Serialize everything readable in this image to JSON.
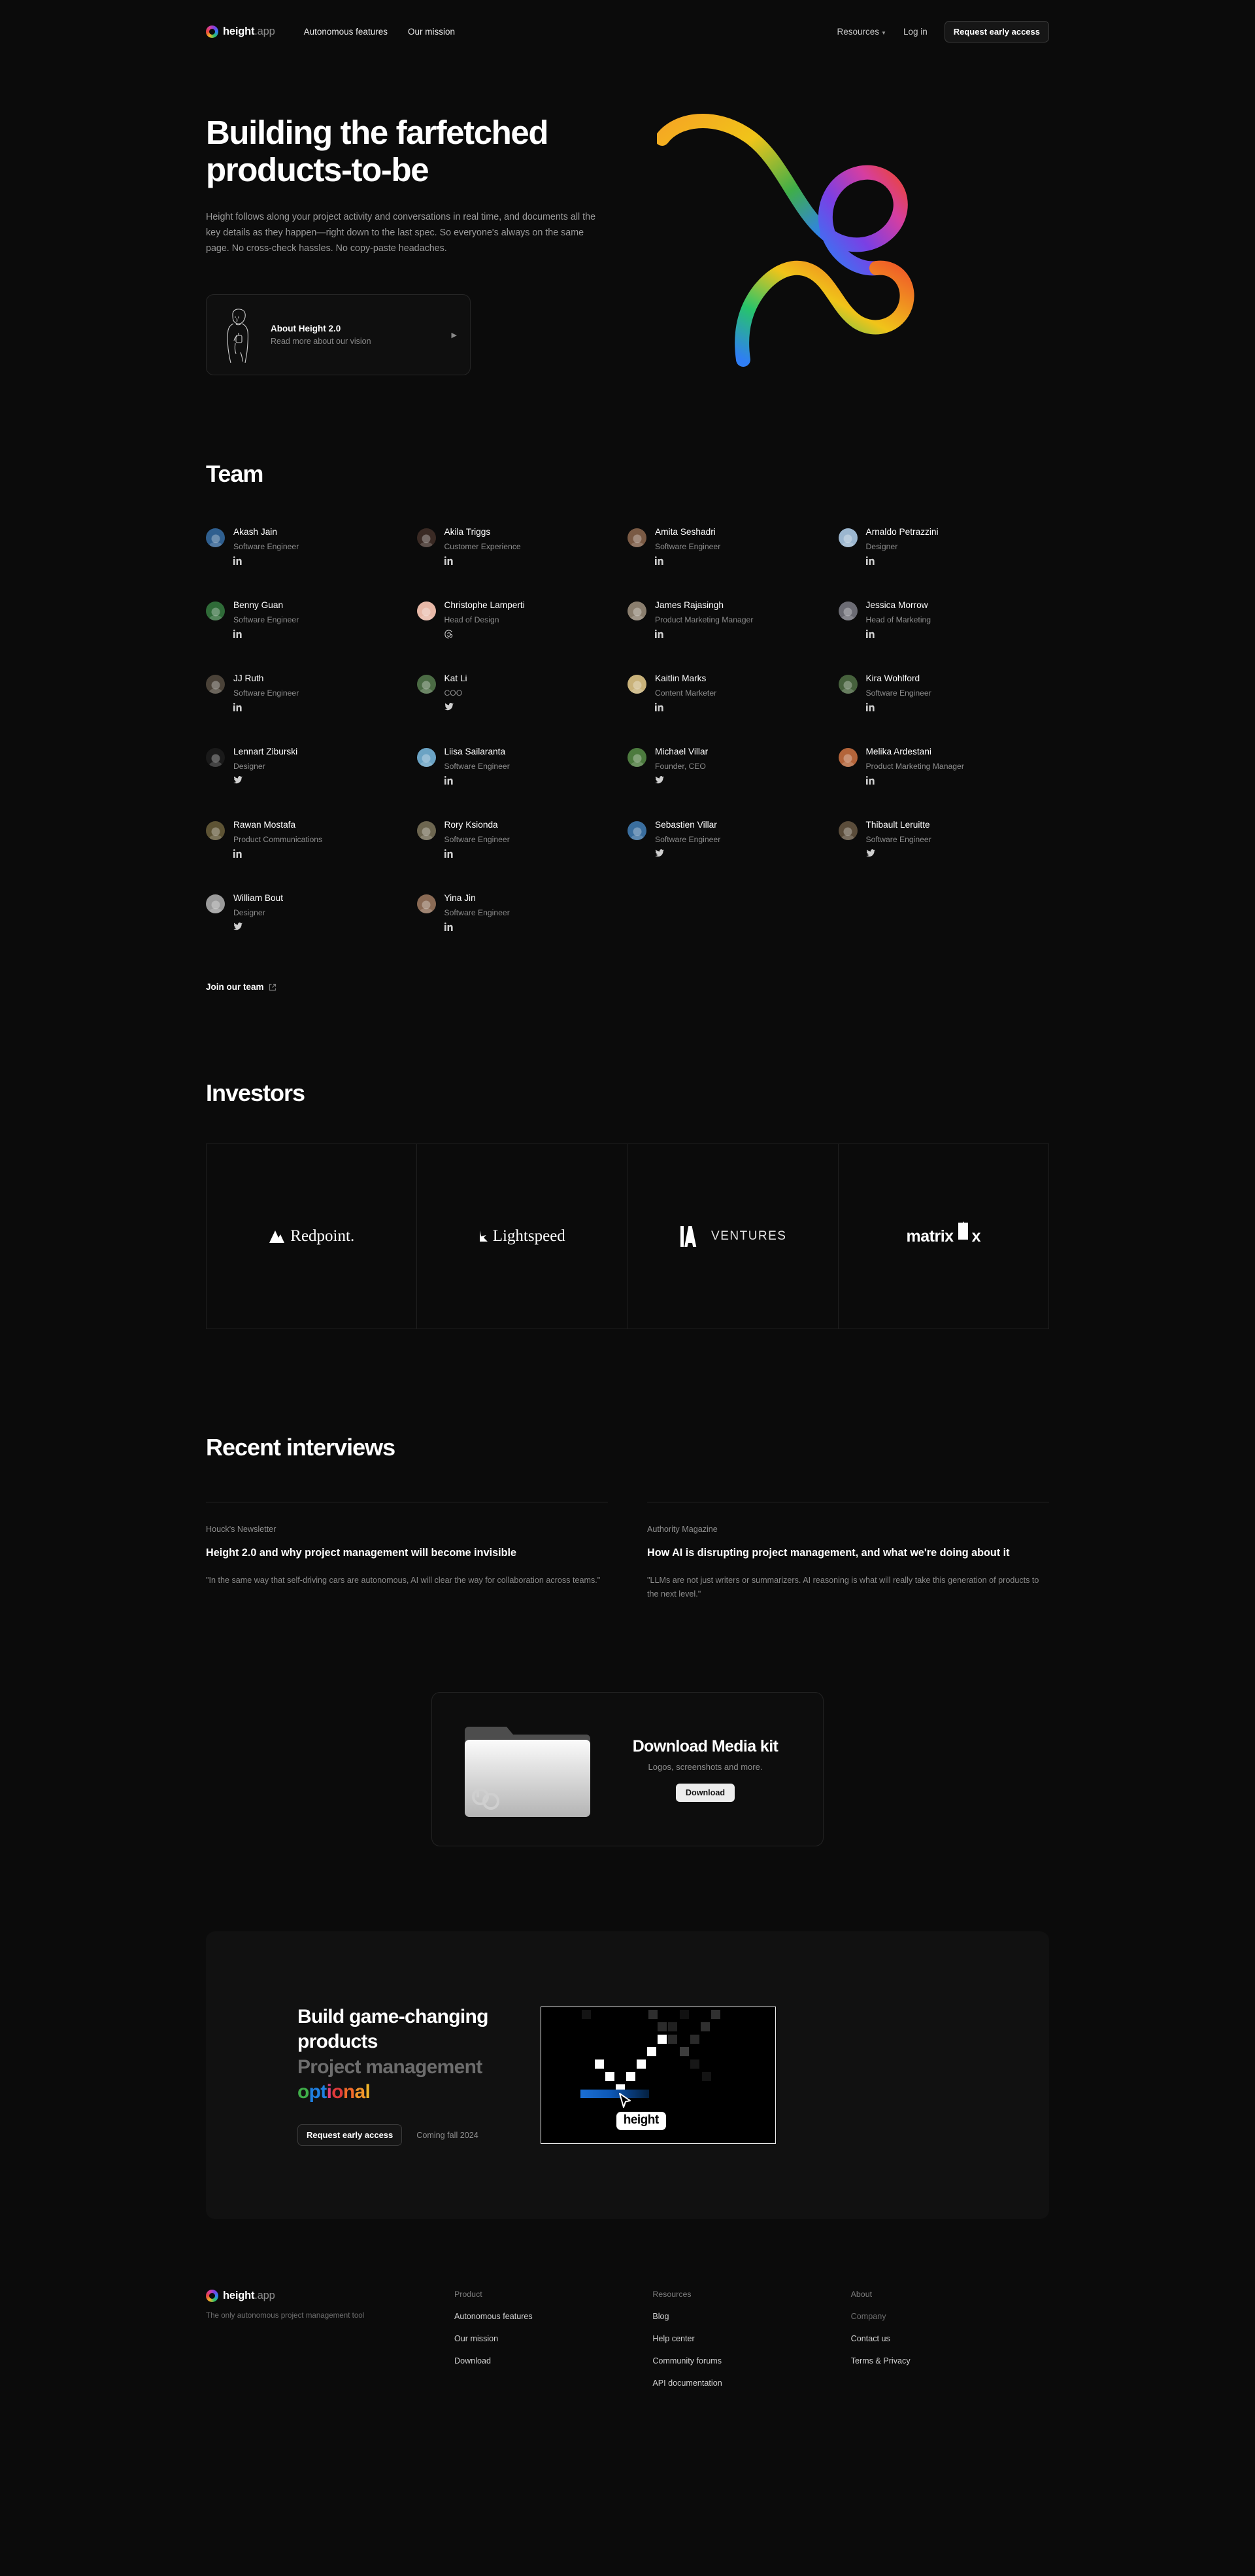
{
  "brand": {
    "name": "height",
    "suffix": ".app",
    "logo_icon": "height-logo-icon"
  },
  "nav": {
    "links": [
      {
        "label": "Autonomous features"
      },
      {
        "label": "Our mission"
      }
    ],
    "resources_label": "Resources",
    "login_label": "Log in",
    "cta_label": "Request early access"
  },
  "hero": {
    "title_line1": "Building the farfetched",
    "title_line2": "products-to-be",
    "subtitle": "Height follows along your project activity and conversations in real time, and documents all the key details as they happen—right down to the last spec. So everyone's always on the same page. No cross-check hassles. No copy-paste headaches.",
    "card": {
      "title": "About Height 2.0",
      "subtitle": "Read more about our vision",
      "arrow_icon": "chevron-right-icon",
      "illustration_icon": "person-illustration-icon"
    }
  },
  "team": {
    "heading": "Team",
    "join_label": "Join our team",
    "join_icon": "external-link-icon",
    "members": [
      {
        "name": "Akash Jain",
        "role": "Software Engineer",
        "social": "linkedin",
        "avatar": "#2f5f8f"
      },
      {
        "name": "Akila Triggs",
        "role": "Customer Experience",
        "social": "linkedin",
        "avatar": "#3a2a24"
      },
      {
        "name": "Amita Seshadri",
        "role": "Software Engineer",
        "social": "linkedin",
        "avatar": "#7a5a44"
      },
      {
        "name": "Arnaldo Petrazzini",
        "role": "Designer",
        "social": "linkedin",
        "avatar": "#9bb6cf"
      },
      {
        "name": "Benny Guan",
        "role": "Software Engineer",
        "social": "linkedin",
        "avatar": "#2f6b38"
      },
      {
        "name": "Christophe Lamperti",
        "role": "Head of Design",
        "social": "threads",
        "avatar": "#e8b9a8"
      },
      {
        "name": "James Rajasingh",
        "role": "Product Marketing Manager",
        "social": "linkedin",
        "avatar": "#8a7e6e"
      },
      {
        "name": "Jessica Morrow",
        "role": "Head of Marketing",
        "social": "linkedin",
        "avatar": "#6b6b73"
      },
      {
        "name": "JJ Ruth",
        "role": "Software Engineer",
        "social": "linkedin",
        "avatar": "#4a4238"
      },
      {
        "name": "Kat Li",
        "role": "COO",
        "social": "twitter",
        "avatar": "#4b6b44"
      },
      {
        "name": "Kaitlin Marks",
        "role": "Content Marketer",
        "social": "linkedin",
        "avatar": "#c9b27a"
      },
      {
        "name": "Kira Wohlford",
        "role": "Software Engineer",
        "social": "linkedin",
        "avatar": "#46613c"
      },
      {
        "name": "Lennart Ziburski",
        "role": "Designer",
        "social": "twitter",
        "avatar": "#1a1a1a"
      },
      {
        "name": "Liisa Sailaranta",
        "role": "Software Engineer",
        "social": "linkedin",
        "avatar": "#6ba3c4"
      },
      {
        "name": "Michael Villar",
        "role": "Founder, CEO",
        "social": "twitter",
        "avatar": "#4c7a3e"
      },
      {
        "name": "Melika Ardestani",
        "role": "Product Marketing Manager",
        "social": "linkedin",
        "avatar": "#b3643a"
      },
      {
        "name": "Rawan Mostafa",
        "role": "Product Communications",
        "social": "linkedin",
        "avatar": "#5d5334"
      },
      {
        "name": "Rory Ksionda",
        "role": "Software Engineer",
        "social": "linkedin",
        "avatar": "#6d6650"
      },
      {
        "name": "Sebastien Villar",
        "role": "Software Engineer",
        "social": "twitter",
        "avatar": "#3a6e9e"
      },
      {
        "name": "Thibault Leruitte",
        "role": "Software Engineer",
        "social": "twitter",
        "avatar": "#5a4c3a"
      },
      {
        "name": "William Bout",
        "role": "Designer",
        "social": "twitter",
        "avatar": "#9a9a9a"
      },
      {
        "name": "Yina Jin",
        "role": "Software Engineer",
        "social": "linkedin",
        "avatar": "#8a6a54"
      }
    ]
  },
  "investors": {
    "heading": "Investors",
    "logos": [
      {
        "name": "Redpoint.",
        "icon": "redpoint-mountain-icon"
      },
      {
        "name": "Lightspeed",
        "icon": "lightspeed-icon"
      },
      {
        "name": "VENTURES",
        "icon": "ia-ventures-icon"
      },
      {
        "name": "matrix",
        "icon": "matrix-icon"
      }
    ]
  },
  "interviews": {
    "heading": "Recent interviews",
    "items": [
      {
        "source": "Houck's Newsletter",
        "title": "Height 2.0 and why project management will become invisible",
        "quote": "\"In the same way that self-driving cars are autonomous, AI will clear the way for collaboration across teams.\""
      },
      {
        "source": "Authority Magazine",
        "title": "How AI is disrupting project management, and what we're doing about it",
        "quote": "\"LLMs are not just writers or summarizers. AI reasoning is what will really take this generation of products to the next level.\""
      }
    ]
  },
  "media_kit": {
    "title": "Download Media kit",
    "subtitle": "Logos, screenshots and more.",
    "button_label": "Download",
    "folder_icon": "folder-icon"
  },
  "cta": {
    "line1": "Build game-changing",
    "line2": "products",
    "line3": "Project management",
    "line4": "optional",
    "button_label": "Request early access",
    "note": "Coming fall 2024",
    "app_label": "height",
    "rainbow_colors": [
      "#3fae49",
      "#1f7fe0",
      "#1f7fe0",
      "#e0407a",
      "#e03a3a",
      "#f06a2a",
      "#f0952a",
      "#f0b42a"
    ]
  },
  "footer": {
    "tagline": "The only autonomous project management tool",
    "columns": [
      {
        "heading": "Product",
        "links": [
          {
            "label": "Autonomous features",
            "muted": false
          },
          {
            "label": "Our mission",
            "muted": false
          },
          {
            "label": "Download",
            "muted": false
          }
        ]
      },
      {
        "heading": "Resources",
        "links": [
          {
            "label": "Blog",
            "muted": false
          },
          {
            "label": "Help center",
            "muted": false
          },
          {
            "label": "Community forums",
            "muted": false
          },
          {
            "label": "API documentation",
            "muted": false
          }
        ]
      },
      {
        "heading": "About",
        "links": [
          {
            "label": "Company",
            "muted": true
          },
          {
            "label": "Contact us",
            "muted": false
          },
          {
            "label": "Terms & Privacy",
            "muted": false
          }
        ]
      }
    ]
  }
}
